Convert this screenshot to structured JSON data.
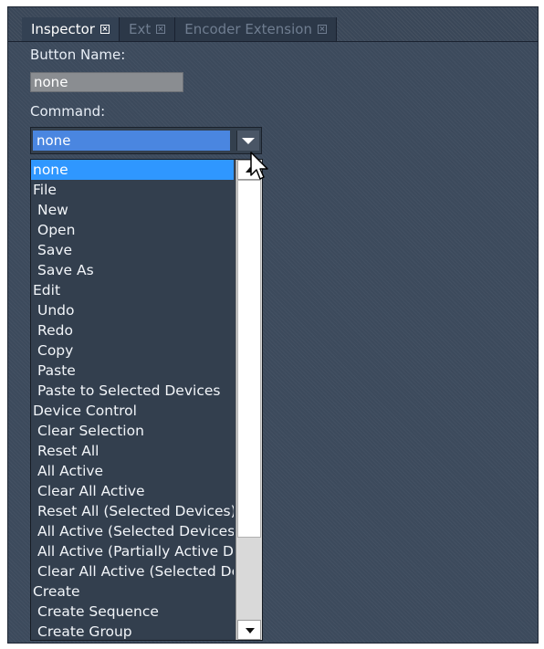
{
  "tabs": [
    {
      "label": "Inspector",
      "active": true
    },
    {
      "label": "Ext",
      "active": false
    },
    {
      "label": "Encoder Extension",
      "active": false
    }
  ],
  "form": {
    "button_name_label": "Button Name:",
    "button_name_value": "none",
    "command_label": "Command:",
    "command_value": "none"
  },
  "dropdown": {
    "items": [
      {
        "label": "none",
        "selected": true,
        "indent": false
      },
      {
        "label": "File",
        "indent": false
      },
      {
        "label": "New",
        "indent": true
      },
      {
        "label": "Open",
        "indent": true
      },
      {
        "label": "Save",
        "indent": true
      },
      {
        "label": "Save As",
        "indent": true
      },
      {
        "label": "Edit",
        "indent": false
      },
      {
        "label": "Undo",
        "indent": true
      },
      {
        "label": "Redo",
        "indent": true
      },
      {
        "label": "Copy",
        "indent": true
      },
      {
        "label": "Paste",
        "indent": true
      },
      {
        "label": "Paste to Selected Devices",
        "indent": true
      },
      {
        "label": "Device Control",
        "indent": false
      },
      {
        "label": "Clear Selection",
        "indent": true
      },
      {
        "label": "Reset All",
        "indent": true
      },
      {
        "label": "All Active",
        "indent": true
      },
      {
        "label": "Clear All Active",
        "indent": true
      },
      {
        "label": "Reset All (Selected Devices)",
        "indent": true
      },
      {
        "label": "All Active (Selected Devices)",
        "indent": true
      },
      {
        "label": "All Active (Partially Active Devices)",
        "indent": true
      },
      {
        "label": "Clear All Active (Selected Devices)",
        "indent": true
      },
      {
        "label": "Create",
        "indent": false
      },
      {
        "label": "Create Sequence",
        "indent": true
      },
      {
        "label": "Create Group",
        "indent": true
      }
    ]
  },
  "colors": {
    "panel_bg": "#3c4a5c",
    "selection": "#2f97ff",
    "combo_value_bg": "#4a86e0"
  }
}
